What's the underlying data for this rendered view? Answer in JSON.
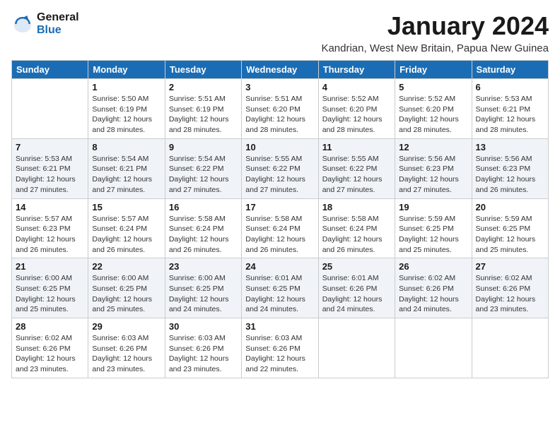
{
  "logo": {
    "line1": "General",
    "line2": "Blue"
  },
  "title": "January 2024",
  "subtitle": "Kandrian, West New Britain, Papua New Guinea",
  "days_of_week": [
    "Sunday",
    "Monday",
    "Tuesday",
    "Wednesday",
    "Thursday",
    "Friday",
    "Saturday"
  ],
  "weeks": [
    [
      {
        "day": "",
        "info": ""
      },
      {
        "day": "1",
        "info": "Sunrise: 5:50 AM\nSunset: 6:19 PM\nDaylight: 12 hours\nand 28 minutes."
      },
      {
        "day": "2",
        "info": "Sunrise: 5:51 AM\nSunset: 6:19 PM\nDaylight: 12 hours\nand 28 minutes."
      },
      {
        "day": "3",
        "info": "Sunrise: 5:51 AM\nSunset: 6:20 PM\nDaylight: 12 hours\nand 28 minutes."
      },
      {
        "day": "4",
        "info": "Sunrise: 5:52 AM\nSunset: 6:20 PM\nDaylight: 12 hours\nand 28 minutes."
      },
      {
        "day": "5",
        "info": "Sunrise: 5:52 AM\nSunset: 6:20 PM\nDaylight: 12 hours\nand 28 minutes."
      },
      {
        "day": "6",
        "info": "Sunrise: 5:53 AM\nSunset: 6:21 PM\nDaylight: 12 hours\nand 28 minutes."
      }
    ],
    [
      {
        "day": "7",
        "info": "Sunrise: 5:53 AM\nSunset: 6:21 PM\nDaylight: 12 hours\nand 27 minutes."
      },
      {
        "day": "8",
        "info": "Sunrise: 5:54 AM\nSunset: 6:21 PM\nDaylight: 12 hours\nand 27 minutes."
      },
      {
        "day": "9",
        "info": "Sunrise: 5:54 AM\nSunset: 6:22 PM\nDaylight: 12 hours\nand 27 minutes."
      },
      {
        "day": "10",
        "info": "Sunrise: 5:55 AM\nSunset: 6:22 PM\nDaylight: 12 hours\nand 27 minutes."
      },
      {
        "day": "11",
        "info": "Sunrise: 5:55 AM\nSunset: 6:22 PM\nDaylight: 12 hours\nand 27 minutes."
      },
      {
        "day": "12",
        "info": "Sunrise: 5:56 AM\nSunset: 6:23 PM\nDaylight: 12 hours\nand 27 minutes."
      },
      {
        "day": "13",
        "info": "Sunrise: 5:56 AM\nSunset: 6:23 PM\nDaylight: 12 hours\nand 26 minutes."
      }
    ],
    [
      {
        "day": "14",
        "info": "Sunrise: 5:57 AM\nSunset: 6:23 PM\nDaylight: 12 hours\nand 26 minutes."
      },
      {
        "day": "15",
        "info": "Sunrise: 5:57 AM\nSunset: 6:24 PM\nDaylight: 12 hours\nand 26 minutes."
      },
      {
        "day": "16",
        "info": "Sunrise: 5:58 AM\nSunset: 6:24 PM\nDaylight: 12 hours\nand 26 minutes."
      },
      {
        "day": "17",
        "info": "Sunrise: 5:58 AM\nSunset: 6:24 PM\nDaylight: 12 hours\nand 26 minutes."
      },
      {
        "day": "18",
        "info": "Sunrise: 5:58 AM\nSunset: 6:24 PM\nDaylight: 12 hours\nand 26 minutes."
      },
      {
        "day": "19",
        "info": "Sunrise: 5:59 AM\nSunset: 6:25 PM\nDaylight: 12 hours\nand 25 minutes."
      },
      {
        "day": "20",
        "info": "Sunrise: 5:59 AM\nSunset: 6:25 PM\nDaylight: 12 hours\nand 25 minutes."
      }
    ],
    [
      {
        "day": "21",
        "info": "Sunrise: 6:00 AM\nSunset: 6:25 PM\nDaylight: 12 hours\nand 25 minutes."
      },
      {
        "day": "22",
        "info": "Sunrise: 6:00 AM\nSunset: 6:25 PM\nDaylight: 12 hours\nand 25 minutes."
      },
      {
        "day": "23",
        "info": "Sunrise: 6:00 AM\nSunset: 6:25 PM\nDaylight: 12 hours\nand 24 minutes."
      },
      {
        "day": "24",
        "info": "Sunrise: 6:01 AM\nSunset: 6:25 PM\nDaylight: 12 hours\nand 24 minutes."
      },
      {
        "day": "25",
        "info": "Sunrise: 6:01 AM\nSunset: 6:26 PM\nDaylight: 12 hours\nand 24 minutes."
      },
      {
        "day": "26",
        "info": "Sunrise: 6:02 AM\nSunset: 6:26 PM\nDaylight: 12 hours\nand 24 minutes."
      },
      {
        "day": "27",
        "info": "Sunrise: 6:02 AM\nSunset: 6:26 PM\nDaylight: 12 hours\nand 23 minutes."
      }
    ],
    [
      {
        "day": "28",
        "info": "Sunrise: 6:02 AM\nSunset: 6:26 PM\nDaylight: 12 hours\nand 23 minutes."
      },
      {
        "day": "29",
        "info": "Sunrise: 6:03 AM\nSunset: 6:26 PM\nDaylight: 12 hours\nand 23 minutes."
      },
      {
        "day": "30",
        "info": "Sunrise: 6:03 AM\nSunset: 6:26 PM\nDaylight: 12 hours\nand 23 minutes."
      },
      {
        "day": "31",
        "info": "Sunrise: 6:03 AM\nSunset: 6:26 PM\nDaylight: 12 hours\nand 22 minutes."
      },
      {
        "day": "",
        "info": ""
      },
      {
        "day": "",
        "info": ""
      },
      {
        "day": "",
        "info": ""
      }
    ]
  ]
}
